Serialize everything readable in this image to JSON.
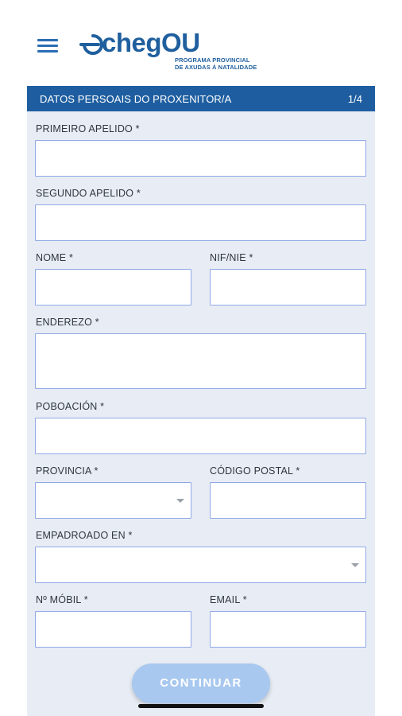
{
  "header": {
    "logo_text": "chegOU",
    "logo_sub_1": "PROGRAMA PROVINCIAL",
    "logo_sub_2": "DE AXUDAS Á NATALIDADE"
  },
  "section": {
    "title": "DATOS PERSOAIS DO PROXENITOR/A",
    "step": "1/4"
  },
  "form": {
    "primeiro_apelido": {
      "label": "PRIMEIRO APELIDO *",
      "value": ""
    },
    "segundo_apelido": {
      "label": "SEGUNDO APELIDO *",
      "value": ""
    },
    "nome": {
      "label": "NOME *",
      "value": ""
    },
    "nif": {
      "label": "NIF/NIE *",
      "value": ""
    },
    "enderezo": {
      "label": "ENDEREZO *",
      "value": ""
    },
    "poboacion": {
      "label": "POBOACIÓN *",
      "value": ""
    },
    "provincia": {
      "label": "PROVINCIA *",
      "value": ""
    },
    "codigo_postal": {
      "label": "CÓDIGO POSTAL *",
      "value": ""
    },
    "empadroado": {
      "label": "EMPADROADO EN *",
      "value": ""
    },
    "mobil": {
      "label": "Nº MÓBIL *",
      "value": ""
    },
    "email": {
      "label": "EMAIL *",
      "value": ""
    }
  },
  "actions": {
    "continue_label": "CONTINUAR"
  },
  "colors": {
    "brand": "#1f5f9e",
    "header_bar": "#1e5ea0",
    "panel_bg": "#e8edf5",
    "field_border": "#8fa8e6",
    "button": "#a8c8ef"
  },
  "icons": [
    "hamburger-menu-icon",
    "chegou-logo-mark",
    "dropdown-caret-icon"
  ]
}
